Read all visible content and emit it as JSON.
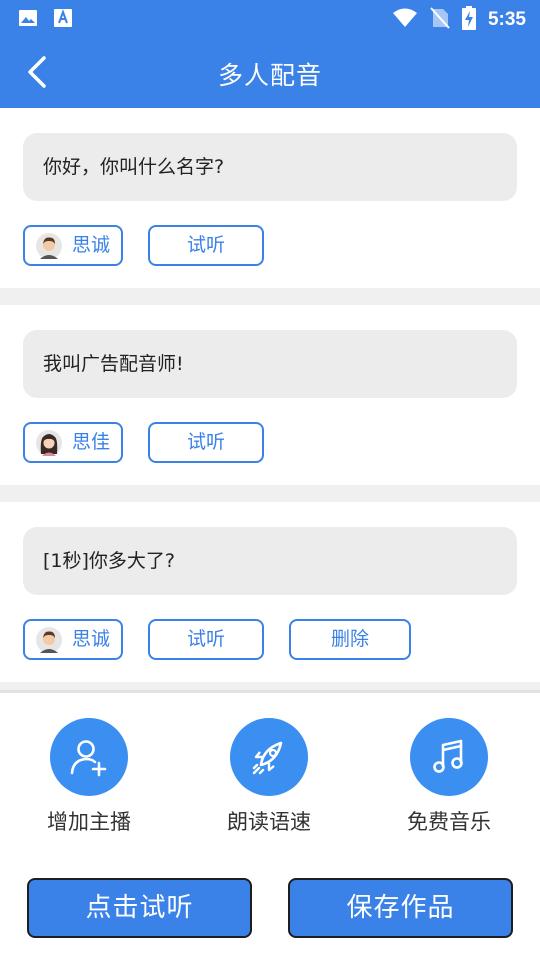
{
  "status_bar": {
    "time": "5:35"
  },
  "header": {
    "title": "多人配音"
  },
  "dialogues": [
    {
      "text": "你好，你叫什么名字?",
      "voice": "思诚",
      "listen_label": "试听"
    },
    {
      "text": "我叫广告配音师!",
      "voice": "思佳",
      "listen_label": "试听"
    },
    {
      "text": "[1秒]你多大了?",
      "voice": "思诚",
      "listen_label": "试听",
      "delete_label": "删除"
    }
  ],
  "tools": {
    "add_host": {
      "label": "增加主播",
      "icon": "add-user-icon"
    },
    "reading_speed": {
      "label": "朗读语速",
      "icon": "rocket-icon"
    },
    "free_music": {
      "label": "免费音乐",
      "icon": "music-note-icon"
    }
  },
  "actions": {
    "preview_label": "点击试听",
    "save_label": "保存作品"
  },
  "colors": {
    "primary": "#3b82e8",
    "icon_circle": "#3b8ff0",
    "bubble": "#ececec",
    "separator": "#f0f0f0"
  }
}
